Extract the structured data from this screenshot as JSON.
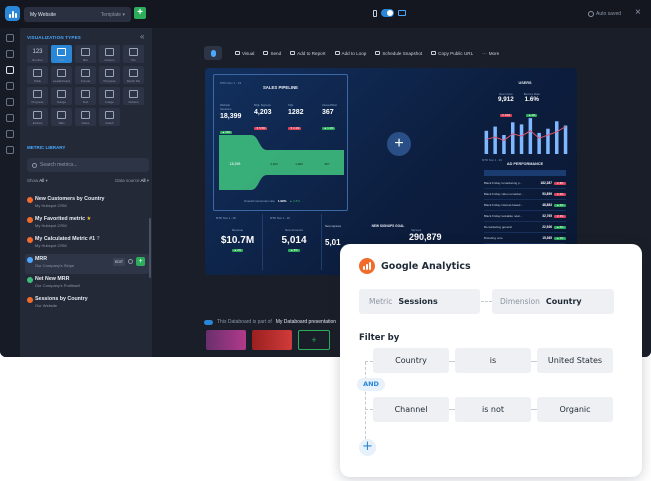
{
  "topbar": {
    "site_name": "My Website",
    "template_label": "Template",
    "add_label": "+",
    "autosave_label": "Auto saved",
    "close_label": "×"
  },
  "panel": {
    "viz_heading": "VISUALIZATION TYPES",
    "collapse_label": "«",
    "viz_first_value": "123",
    "viz_types": [
      "Number",
      "Line",
      "Bar",
      "Column",
      "Pie",
      "Table",
      "Leaderboard",
      "Funnel",
      "Progress",
      "Metric Pie",
      "Progress",
      "Gauge",
      "Text",
      "Image",
      "Custom",
      "Embed",
      "Tabs",
      "Notes",
      "Graph",
      ""
    ],
    "metric_heading": "METRIC LIBRARY",
    "search_placeholder": "Search metrics...",
    "show_label": "Show",
    "show_value": "All",
    "data_source_label": "Data source",
    "data_source_value": "All",
    "metrics": [
      {
        "name": "New Customers by Country",
        "sub": "My Hubspot CRM",
        "color": "orange"
      },
      {
        "name": "My Favorited metric",
        "sub": "My Hubspot CRM",
        "color": "orange",
        "star": "★"
      },
      {
        "name": "My Calculated Metric #1",
        "sub": "My Hubspot CRM",
        "color": "orange",
        "info": "?"
      },
      {
        "name": "MRR",
        "sub": "Our Company's Stripe",
        "color": "blue",
        "edit": "EDIT",
        "add": "+"
      },
      {
        "name": "Net New MRR",
        "sub": "Our Company's Profitwell",
        "color": "teal"
      },
      {
        "name": "Sessions by Country",
        "sub": "Our Website",
        "color": "orange"
      }
    ]
  },
  "toolbar": {
    "items": [
      "Visual",
      "Send",
      "Add to Report",
      "Add to Loop",
      "Schedule Snapshot",
      "Copy Public URL",
      "More"
    ]
  },
  "dashboard": {
    "header_date": "MTD Nov 1 - 19",
    "pipeline": {
      "title": "SALES PIPELINE",
      "stats": [
        {
          "label": "Website Sessions",
          "value": "18,399",
          "change": "▲ 16%",
          "trend": "up"
        },
        {
          "label": "MQL Signups",
          "value": "4,203",
          "change": "▼ 5.5%",
          "trend": "down"
        },
        {
          "label": "SQL",
          "value": "1282",
          "change": "▼ 2.1%",
          "trend": "down"
        },
        {
          "label": "Closed/Won",
          "value": "367",
          "change": "▲ 1.1%",
          "trend": "up"
        }
      ],
      "stage_labels": [
        "18,399",
        "4,203",
        "1,282",
        "367"
      ],
      "conversion_label": "Overall conversion rate",
      "conversion_value": "1.99%",
      "conversion_change": "▲ 0.8%"
    },
    "drop_label": "+",
    "users": {
      "title": "USERS",
      "metrics": [
        {
          "label": "New Users",
          "value": "9,912",
          "change": "▼ 12%",
          "trend": "down"
        },
        {
          "label": "Bounce Rate",
          "value": "1.6%",
          "change": "▲ 2%",
          "trend": "up"
        }
      ],
      "bars": [
        22,
        26,
        18,
        30,
        28,
        34,
        20,
        24,
        31,
        27
      ],
      "line": [
        14,
        16,
        13,
        19,
        17,
        22,
        15,
        18,
        21,
        26
      ]
    },
    "performance": {
      "date": "MTD Nov 1 - 19",
      "title": "AD PERFORMANCE",
      "rows": [
        {
          "name": "Black Friday remarketing p...",
          "value": "182,387",
          "change": "▼ 6%",
          "trend": "down"
        },
        {
          "name": "Black Friday video remarket...",
          "value": "53,899",
          "change": "▼ 4%",
          "trend": "down"
        },
        {
          "name": "Black Friday interest-based...",
          "value": "48,883",
          "change": "▲ 2%",
          "trend": "up"
        },
        {
          "name": "Black Friday lookalike retar...",
          "value": "32,765",
          "change": "▼ 3%",
          "trend": "down"
        },
        {
          "name": "Remarketing general",
          "value": "22,926",
          "change": "▲ 5%",
          "trend": "up"
        },
        {
          "name": "Branding core",
          "value": "15,365",
          "change": "▲ 1%",
          "trend": "up"
        }
      ]
    },
    "kpis": [
      {
        "label": "MTD Nov 1 - 19",
        "small": "Revenue",
        "value": "$10.7M",
        "change": "▲ 2%"
      },
      {
        "label": "MTD Nov 1 - 19",
        "small": "New Accounts",
        "value": "5,014",
        "change": "▲ 6%"
      }
    ],
    "new_deals": {
      "label": "New signups",
      "value": "5,01"
    },
    "goal": {
      "title": "NEW SIGNUPS GOAL",
      "label": "Signups",
      "value": "290,879"
    }
  },
  "footer": {
    "notice_prefix": "This Databoard is part of",
    "notice_link": "My Databoard presentation",
    "add_label": "+"
  },
  "ga_card": {
    "title": "Google Analytics",
    "metric_key": "Metric",
    "metric_value": "Sessions",
    "dimension_key": "Dimension",
    "dimension_value": "Country",
    "filter_title": "Filter by",
    "filters": [
      {
        "field": "Country",
        "operator": "is",
        "value": "United States"
      },
      {
        "field": "Channel",
        "operator": "is not",
        "value": "Organic"
      }
    ],
    "and_label": "AND",
    "add_label": "+"
  },
  "colors": {
    "accent": "#2a86d6",
    "green": "#2dac5c",
    "orange": "#f36b2b",
    "red": "#d9435b",
    "teal": "#3dbd7d"
  }
}
